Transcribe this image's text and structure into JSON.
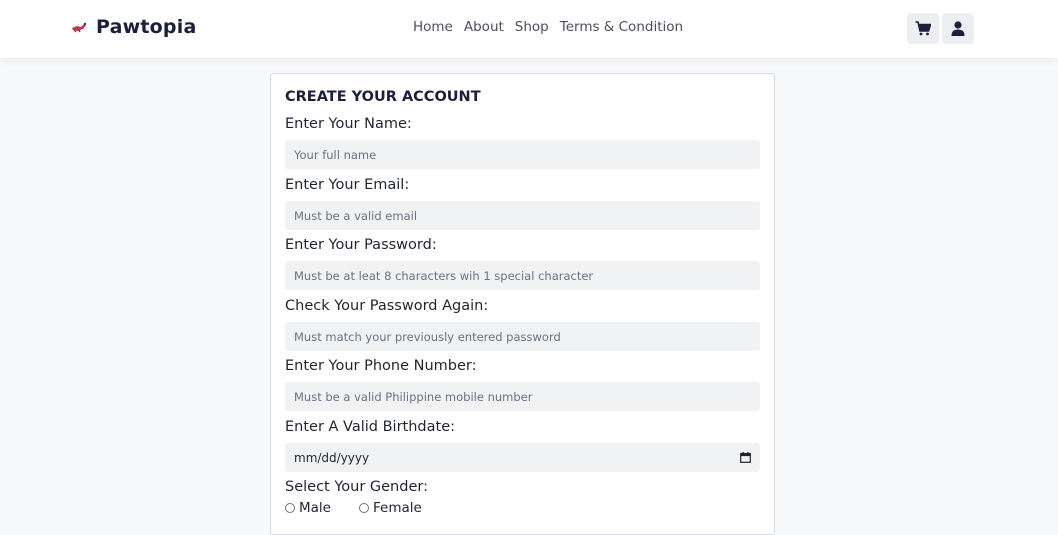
{
  "brand": {
    "name": "Pawtopia",
    "logo_icon": "pet-logo-icon"
  },
  "nav": {
    "links": [
      "Home",
      "About",
      "Shop",
      "Terms & Condition"
    ]
  },
  "header_icons": {
    "cart": "cart-icon",
    "user": "user-icon"
  },
  "form": {
    "title": "CREATE YOUR ACCOUNT",
    "fields": [
      {
        "label": "Enter Your Name:",
        "placeholder": "Your full name"
      },
      {
        "label": "Enter Your Email:",
        "placeholder": "Must be a valid email"
      },
      {
        "label": "Enter Your Password:",
        "placeholder": "Must be at leat 8 characters wih 1 special character"
      },
      {
        "label": "Check Your Password Again:",
        "placeholder": "Must match your previously entered password"
      },
      {
        "label": "Enter Your Phone Number:",
        "placeholder": "Must be a valid Philippine mobile number"
      },
      {
        "label": "Enter A Valid Birthdate:",
        "placeholder": "mm/dd/yyyy"
      }
    ],
    "gender": {
      "label": "Select Your Gender:",
      "options": [
        "Male",
        "Female"
      ]
    }
  },
  "colors": {
    "brand_text": "#1b1f3a",
    "input_bg": "#f1f2f4",
    "logo_accent": "#c8334a"
  }
}
